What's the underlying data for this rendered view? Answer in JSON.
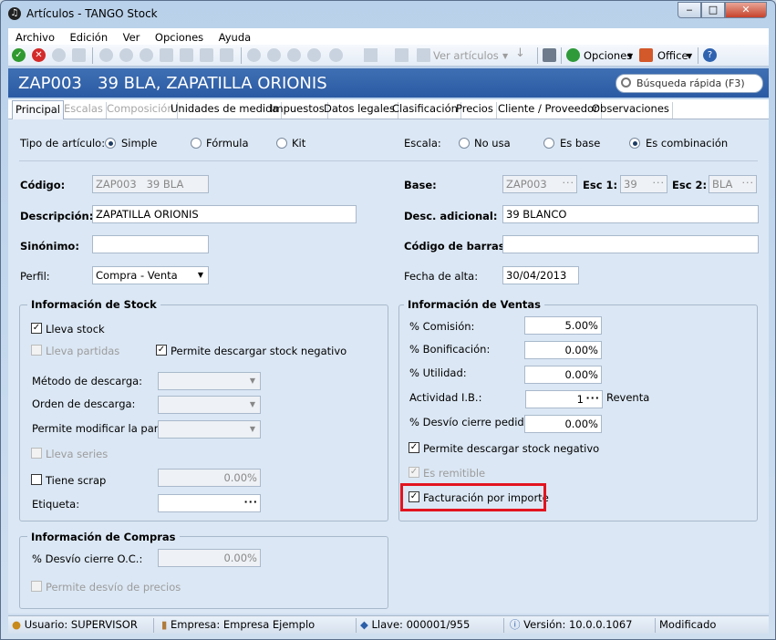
{
  "window": {
    "title": "Artículos - TANGO Stock"
  },
  "menu": [
    "Archivo",
    "Edición",
    "Ver",
    "Opciones",
    "Ayuda"
  ],
  "toolbar": {
    "ver_articulos": "Ver artículos",
    "opciones": "Opciones",
    "office": "Office"
  },
  "header": {
    "code": "ZAP003",
    "name": "39 BLA, ZAPATILLA ORIONIS",
    "search_placeholder": "Búsqueda rápida (F3)"
  },
  "tabs": [
    "Principal",
    "Escalas",
    "Composición",
    "Unidades de medida",
    "Impuestos",
    "Datos legales",
    "Clasificación",
    "Precios",
    "Cliente / Proveedor",
    "Observaciones"
  ],
  "form": {
    "tipo_label": "Tipo de artículo:",
    "tipo_simple": "Simple",
    "tipo_formula": "Fórmula",
    "tipo_kit": "Kit",
    "escala_label": "Escala:",
    "escala_no_usa": "No usa",
    "escala_es_base": "Es base",
    "escala_comb": "Es combinación",
    "codigo_label": "Código:",
    "codigo_value": "ZAP003   39 BLA",
    "base_label": "Base:",
    "base_value": "ZAP003",
    "esc1_label": "Esc 1:",
    "esc1_value": "39",
    "esc2_label": "Esc 2:",
    "esc2_value": "BLA",
    "descripcion_label": "Descripción:",
    "descripcion_value": "ZAPATILLA ORIONIS",
    "desc_adic_label": "Desc. adicional:",
    "desc_adic_value": "39 BLANCO",
    "sinonimo_label": "Sinónimo:",
    "sinonimo_value": "",
    "codbarras_label": "Código de barras:",
    "codbarras_value": "",
    "perfil_label": "Perfil:",
    "perfil_value": "Compra - Venta",
    "fecha_label": "Fecha de alta:",
    "fecha_value": "30/04/2013"
  },
  "stock": {
    "title": "Información de Stock",
    "lleva_stock": "Lleva stock",
    "lleva_partidas": "Lleva partidas",
    "permite_negativo": "Permite descargar stock negativo",
    "metodo": "Método de descarga:",
    "orden": "Orden de descarga:",
    "modificar_partida": "Permite modificar la partida:",
    "lleva_series": "Lleva series",
    "tiene_scrap": "Tiene scrap",
    "scrap_value": "0.00%",
    "etiqueta": "Etiqueta:"
  },
  "compras": {
    "title": "Información de Compras",
    "desvio": "% Desvío cierre O.C.:",
    "desvio_value": "0.00%",
    "permite_desvio": "Permite desvío de precios"
  },
  "ventas": {
    "title": "Información de Ventas",
    "comision": "% Comisión:",
    "comision_value": "5.00%",
    "bonificacion": "% Bonificación:",
    "bonificacion_value": "0.00%",
    "utilidad": "% Utilidad:",
    "utilidad_value": "0.00%",
    "actividad": "Actividad I.B.:",
    "actividad_value": "1",
    "actividad_desc": "Reventa",
    "desvio": "% Desvío cierre pedidos:",
    "desvio_value": "0.00%",
    "permite_negativo": "Permite descargar stock negativo",
    "es_remitible": "Es remitible",
    "facturacion": "Facturación por importe"
  },
  "status": {
    "usuario": "Usuario: SUPERVISOR",
    "empresa": "Empresa: Empresa Ejemplo",
    "llave": "Llave: 000001/955",
    "version": "Versión: 10.0.0.1067",
    "estado": "Modificado"
  },
  "colors": {
    "header": "#2a5aa3",
    "highlight": "#e2141f"
  }
}
